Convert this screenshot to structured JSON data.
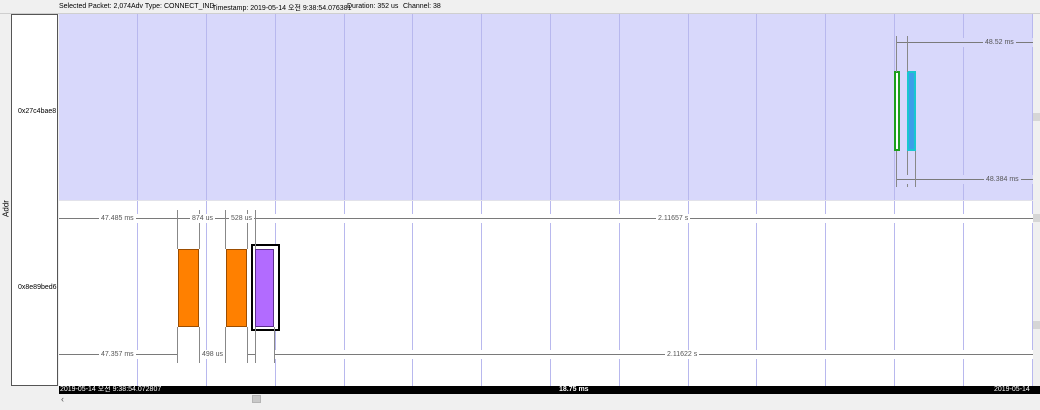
{
  "status": {
    "selected_packet": "Selected Packet: 2,074",
    "adv_type": "Adv Type: CONNECT_IND",
    "timestamp": "Timestamp: 2019-05-14 오전 9:38:54.076381",
    "duration": "Duration: 352 us",
    "channel": "Channel: 38"
  },
  "axis_label": "Addr",
  "addresses": [
    "0x27c4bae8",
    "0x8e89bed6"
  ],
  "measurements": {
    "top_above": "48.52 ms",
    "top_below": "48.384 ms",
    "bot_above": [
      "47.485 ms",
      "874 us",
      "528 us",
      "2.11657 s"
    ],
    "bot_below": [
      "47.357 ms",
      "498 us",
      "2.11622 s"
    ]
  },
  "timebar": {
    "start": "2019-05-14 오전 9:38:54.072807",
    "center": "18.75 ms",
    "end": "2019-05-14"
  },
  "scroll": {
    "left_arrow": "‹"
  },
  "colors": {
    "row_top": "#d8d8fb",
    "grid": "#b8b8ee",
    "orange": "#ff8000",
    "purple": "#b26bff",
    "blue": "#3aa0e8",
    "green_outline": "#1ca01c"
  }
}
